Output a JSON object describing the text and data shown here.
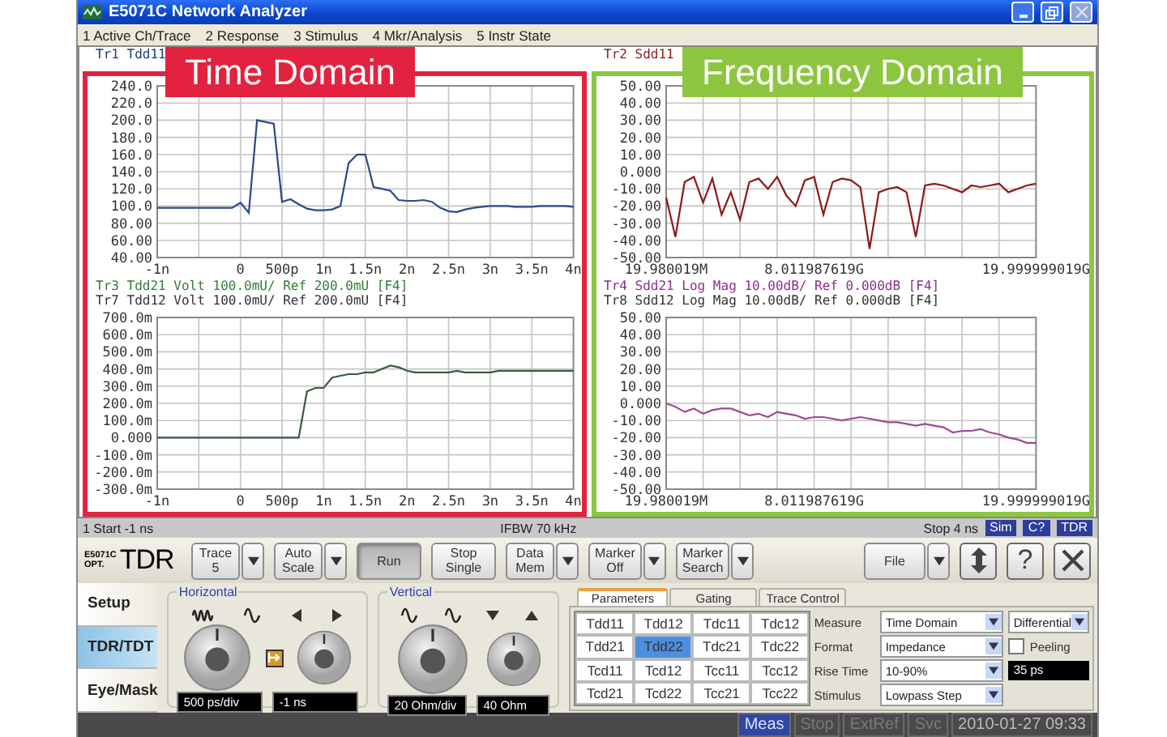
{
  "window": {
    "title": "E5071C Network Analyzer"
  },
  "menu": [
    "1 Active Ch/Trace",
    "2 Response",
    "3 Stimulus",
    "4 Mkr/Analysis",
    "5 Instr State"
  ],
  "panes": [
    {
      "traces": [
        {
          "label": "Tr1 Tdd11",
          "color": "#1a3a80"
        }
      ],
      "chart_data": {
        "type": "line",
        "grid": true,
        "categories": [
          "-1n",
          null,
          null,
          null,
          null,
          null,
          null,
          null,
          null,
          null,
          "0",
          null,
          null,
          null,
          null,
          "500p",
          null,
          null,
          null,
          null,
          "1n",
          null,
          null,
          null,
          null,
          "1.5n",
          null,
          null,
          null,
          null,
          "2n",
          null,
          null,
          null,
          null,
          "2.5n",
          null,
          null,
          null,
          null,
          "3n",
          null,
          null,
          null,
          null,
          "3.5n",
          null,
          null,
          null,
          null,
          "4n"
        ],
        "series": [
          {
            "color": "#2a4a8a",
            "values": [
              98,
              98,
              98,
              98,
              98,
              98,
              98,
              98,
              98,
              98,
              104,
              92,
              200,
              198,
              196,
              105,
              108,
              102,
              97,
              95,
              95,
              96,
              100,
              150,
              160,
              160,
              122,
              120,
              118,
              107,
              106,
              106,
              107,
              105,
              98,
              94,
              93,
              96,
              98,
              99,
              100,
              100,
              100,
              99,
              99,
              99,
              100,
              100,
              100,
              100,
              99
            ]
          }
        ],
        "ylim": [
          40,
          240
        ],
        "yticks": [
          {
            "value": 240,
            "label": "240.0"
          },
          {
            "value": 220,
            "label": "220.0"
          },
          {
            "value": 200,
            "label": "200.0"
          },
          {
            "value": 180,
            "label": "180.0"
          },
          {
            "value": 160,
            "label": "160.0"
          },
          {
            "value": 140,
            "label": "140.0"
          },
          {
            "value": 120,
            "label": "120.0"
          },
          {
            "value": 100,
            "label": "100.0"
          },
          {
            "value": 80,
            "label": "80.00"
          },
          {
            "value": 60,
            "label": "60.00"
          },
          {
            "value": 40,
            "label": "40.00"
          }
        ]
      }
    },
    {
      "traces": [
        {
          "label": "Tr2 Sdd11",
          "color": "#8b1a1a"
        }
      ],
      "chart_data": {
        "type": "line",
        "grid": true,
        "categories": [
          "19.980019M",
          null,
          null,
          null,
          null,
          null,
          null,
          null,
          null,
          null,
          null,
          null,
          null,
          null,
          null,
          null,
          "8.011987619G",
          null,
          null,
          null,
          null,
          null,
          null,
          null,
          null,
          null,
          null,
          null,
          null,
          null,
          null,
          null,
          null,
          null,
          null,
          null,
          null,
          null,
          null,
          null,
          "19.999999019G"
        ],
        "series": [
          {
            "color": "#8b1a1a",
            "values": [
              -15,
              -38,
              -6,
              -3,
              -18,
              -4,
              -25,
              -12,
              -28,
              -6,
              -4,
              -10,
              -3,
              -14,
              -20,
              -5,
              -3,
              -25,
              -6,
              -4,
              -5,
              -9,
              -45,
              -12,
              -10,
              -9,
              -12,
              -38,
              -8,
              -7,
              -8,
              -10,
              -12,
              -8,
              -9,
              -8,
              -7,
              -12,
              -10,
              -8,
              -7
            ]
          }
        ],
        "ylim": [
          -50,
          50
        ],
        "yticks": [
          {
            "value": 50,
            "label": "50.00"
          },
          {
            "value": 40,
            "label": "40.00"
          },
          {
            "value": 30,
            "label": "30.00"
          },
          {
            "value": 20,
            "label": "20.00"
          },
          {
            "value": 10,
            "label": "10.00"
          },
          {
            "value": 0,
            "label": "0.000"
          },
          {
            "value": -10,
            "label": "-10.00"
          },
          {
            "value": -20,
            "label": "-20.00"
          },
          {
            "value": -30,
            "label": "-30.00"
          },
          {
            "value": -40,
            "label": "-40.00"
          },
          {
            "value": -50,
            "label": "-50.00"
          }
        ]
      }
    },
    {
      "traces": [
        {
          "label": "Tr3 Tdd21 Volt 100.0mU/ Ref 200.0mU [F4]",
          "color": "#2e7d32"
        },
        {
          "label": "Tr7 Tdd12 Volt 100.0mU/ Ref 200.0mU [F4]",
          "color": "#333333"
        }
      ],
      "chart_data": {
        "type": "line",
        "grid": true,
        "categories": [
          "-1n",
          null,
          null,
          null,
          null,
          null,
          null,
          null,
          null,
          null,
          "0",
          null,
          null,
          null,
          null,
          "500p",
          null,
          null,
          null,
          null,
          "1n",
          null,
          null,
          null,
          null,
          "1.5n",
          null,
          null,
          null,
          null,
          "2n",
          null,
          null,
          null,
          null,
          "2.5n",
          null,
          null,
          null,
          null,
          "3n",
          null,
          null,
          null,
          null,
          "3.5n",
          null,
          null,
          null,
          null,
          "4n"
        ],
        "series": [
          {
            "color": "#3c5a3c",
            "values": [
              0,
              0,
              0,
              0,
              0,
              0,
              0,
              0,
              0,
              0,
              0,
              0,
              0,
              0,
              0,
              0,
              0,
              0,
              270,
              290,
              290,
              350,
              360,
              370,
              370,
              380,
              380,
              400,
              420,
              410,
              390,
              380,
              380,
              380,
              380,
              380,
              390,
              380,
              380,
              380,
              380,
              390,
              390,
              390,
              390,
              390,
              390,
              390,
              390,
              390,
              390
            ]
          }
        ],
        "ylim": [
          -300,
          700
        ],
        "yticks": [
          {
            "value": 700,
            "label": "700.0m"
          },
          {
            "value": 600,
            "label": "600.0m"
          },
          {
            "value": 500,
            "label": "500.0m"
          },
          {
            "value": 400,
            "label": "400.0m"
          },
          {
            "value": 300,
            "label": "300.0m"
          },
          {
            "value": 200,
            "label": "200.0m"
          },
          {
            "value": 100,
            "label": "100.0m"
          },
          {
            "value": 0,
            "label": "0.000"
          },
          {
            "value": -100,
            "label": "-100.0m"
          },
          {
            "value": -200,
            "label": "-200.0m"
          },
          {
            "value": -300,
            "label": "-300.0m"
          }
        ]
      }
    },
    {
      "traces": [
        {
          "label": "Tr4 Sdd21 Log Mag 10.00dB/ Ref 0.000dB [F4]",
          "color": "#8e2b8e"
        },
        {
          "label": "Tr8 Sdd12 Log Mag 10.00dB/ Ref 0.000dB [F4]",
          "color": "#333333"
        }
      ],
      "chart_data": {
        "type": "line",
        "grid": true,
        "categories": [
          "19.980019M",
          null,
          null,
          null,
          null,
          null,
          null,
          null,
          null,
          null,
          null,
          null,
          null,
          null,
          null,
          null,
          "8.011987619G",
          null,
          null,
          null,
          null,
          null,
          null,
          null,
          null,
          null,
          null,
          null,
          null,
          null,
          null,
          null,
          null,
          null,
          null,
          null,
          null,
          null,
          null,
          null,
          "19.999999019G"
        ],
        "series": [
          {
            "color": "#9b4a9b",
            "values": [
              0,
              -2,
              -5,
              -3,
              -6,
              -4,
              -3,
              -3,
              -5,
              -7,
              -6,
              -8,
              -5,
              -6,
              -7,
              -9,
              -8,
              -8,
              -9,
              -10,
              -9,
              -8,
              -9,
              -10,
              -11,
              -11,
              -12,
              -13,
              -12,
              -13,
              -14,
              -17,
              -16,
              -16,
              -15,
              -17,
              -18,
              -20,
              -21,
              -23,
              -23
            ]
          }
        ],
        "ylim": [
          -50,
          50
        ],
        "yticks": [
          {
            "value": 50,
            "label": "50.00"
          },
          {
            "value": 40,
            "label": "40.00"
          },
          {
            "value": 30,
            "label": "30.00"
          },
          {
            "value": 20,
            "label": "20.00"
          },
          {
            "value": 10,
            "label": "10.00"
          },
          {
            "value": 0,
            "label": "0.000"
          },
          {
            "value": -10,
            "label": "-10.00"
          },
          {
            "value": -20,
            "label": "-20.00"
          },
          {
            "value": -30,
            "label": "-30.00"
          },
          {
            "value": -40,
            "label": "-40.00"
          },
          {
            "value": -50,
            "label": "-50.00"
          }
        ]
      }
    }
  ],
  "overlays": [
    {
      "label": "Time Domain",
      "color": "#e3223f"
    },
    {
      "label": "Frequency Domain",
      "color": "#8cc63f"
    }
  ],
  "status_bar": {
    "start": "1 Start -1 ns",
    "ifbw": "IFBW 70 kHz",
    "stop": "Stop 4 ns",
    "badges": [
      "Sim",
      "C?",
      "TDR"
    ]
  },
  "logo": {
    "model": "E5071C",
    "option": "OPT.",
    "name": "TDR"
  },
  "toolbar": [
    {
      "lines": [
        "Trace",
        "5"
      ],
      "kind": "dropdown",
      "pressed": false
    },
    {
      "lines": [
        "Auto",
        "Scale"
      ],
      "kind": "dropdown",
      "pressed": false
    },
    {
      "lines": [
        "Run"
      ],
      "kind": "plain",
      "pressed": true
    },
    {
      "lines": [
        "Stop",
        "Single"
      ],
      "kind": "plain",
      "pressed": false
    },
    {
      "lines": [
        "Data",
        "Mem"
      ],
      "kind": "dropdown",
      "pressed": false
    },
    {
      "lines": [
        "Marker",
        "Off"
      ],
      "kind": "dropdown",
      "pressed": false
    },
    {
      "lines": [
        "Marker",
        "Search"
      ],
      "kind": "dropdown",
      "pressed": false
    }
  ],
  "right_toolbar": [
    {
      "kind": "file",
      "label": "File"
    },
    {
      "kind": "updown"
    },
    {
      "kind": "help",
      "label": "?"
    },
    {
      "kind": "close"
    }
  ],
  "side_tabs": [
    {
      "label": "Setup",
      "selected": false
    },
    {
      "label": "TDR/TDT",
      "selected": true
    },
    {
      "label": "Eye/Mask",
      "selected": false
    }
  ],
  "groups": [
    {
      "kind": "horizontal",
      "title": "Horizontal",
      "scale": "500 ps/div",
      "position": "-1 ns"
    },
    {
      "kind": "vertical",
      "title": "Vertical",
      "scale": "20 Ohm/div",
      "position": "40 Ohm"
    }
  ],
  "param_tabs": [
    {
      "label": "Parameters",
      "selected": true
    },
    {
      "label": "Gating",
      "selected": false
    },
    {
      "label": "Trace Control",
      "selected": false
    }
  ],
  "parameter_grid": [
    [
      {
        "label": "Tdd11",
        "selected": false
      },
      {
        "label": "Tdd12",
        "selected": false
      },
      {
        "label": "Tdc11",
        "selected": false
      },
      {
        "label": "Tdc12",
        "selected": false
      }
    ],
    [
      {
        "label": "Tdd21",
        "selected": false
      },
      {
        "label": "Tdd22",
        "selected": true
      },
      {
        "label": "Tdc21",
        "selected": false
      },
      {
        "label": "Tdc22",
        "selected": false
      }
    ],
    [
      {
        "label": "Tcd11",
        "selected": false
      },
      {
        "label": "Tcd12",
        "selected": false
      },
      {
        "label": "Tcc11",
        "selected": false
      },
      {
        "label": "Tcc12",
        "selected": false
      }
    ],
    [
      {
        "label": "Tcd21",
        "selected": false
      },
      {
        "label": "Tcd22",
        "selected": false
      },
      {
        "label": "Tcc21",
        "selected": false
      },
      {
        "label": "Tcc22",
        "selected": false
      }
    ]
  ],
  "settings": {
    "measure": {
      "label": "Measure",
      "value": "Time Domain",
      "mode": "Differential"
    },
    "format": {
      "label": "Format",
      "value": "Impedance",
      "peeling": {
        "label": "Peeling",
        "checked": false
      }
    },
    "rise_time": {
      "label": "Rise Time",
      "value": "10-90%",
      "reading": "35 ps"
    },
    "stimulus": {
      "label": "Stimulus",
      "value": "Lowpass Step"
    }
  },
  "bottom_status": {
    "indicators": [
      {
        "label": "Meas",
        "on": true
      },
      {
        "label": "Stop",
        "on": false
      },
      {
        "label": "ExtRef",
        "on": false
      },
      {
        "label": "Svc",
        "on": false
      }
    ],
    "clock": "2010-01-27 09:33"
  }
}
